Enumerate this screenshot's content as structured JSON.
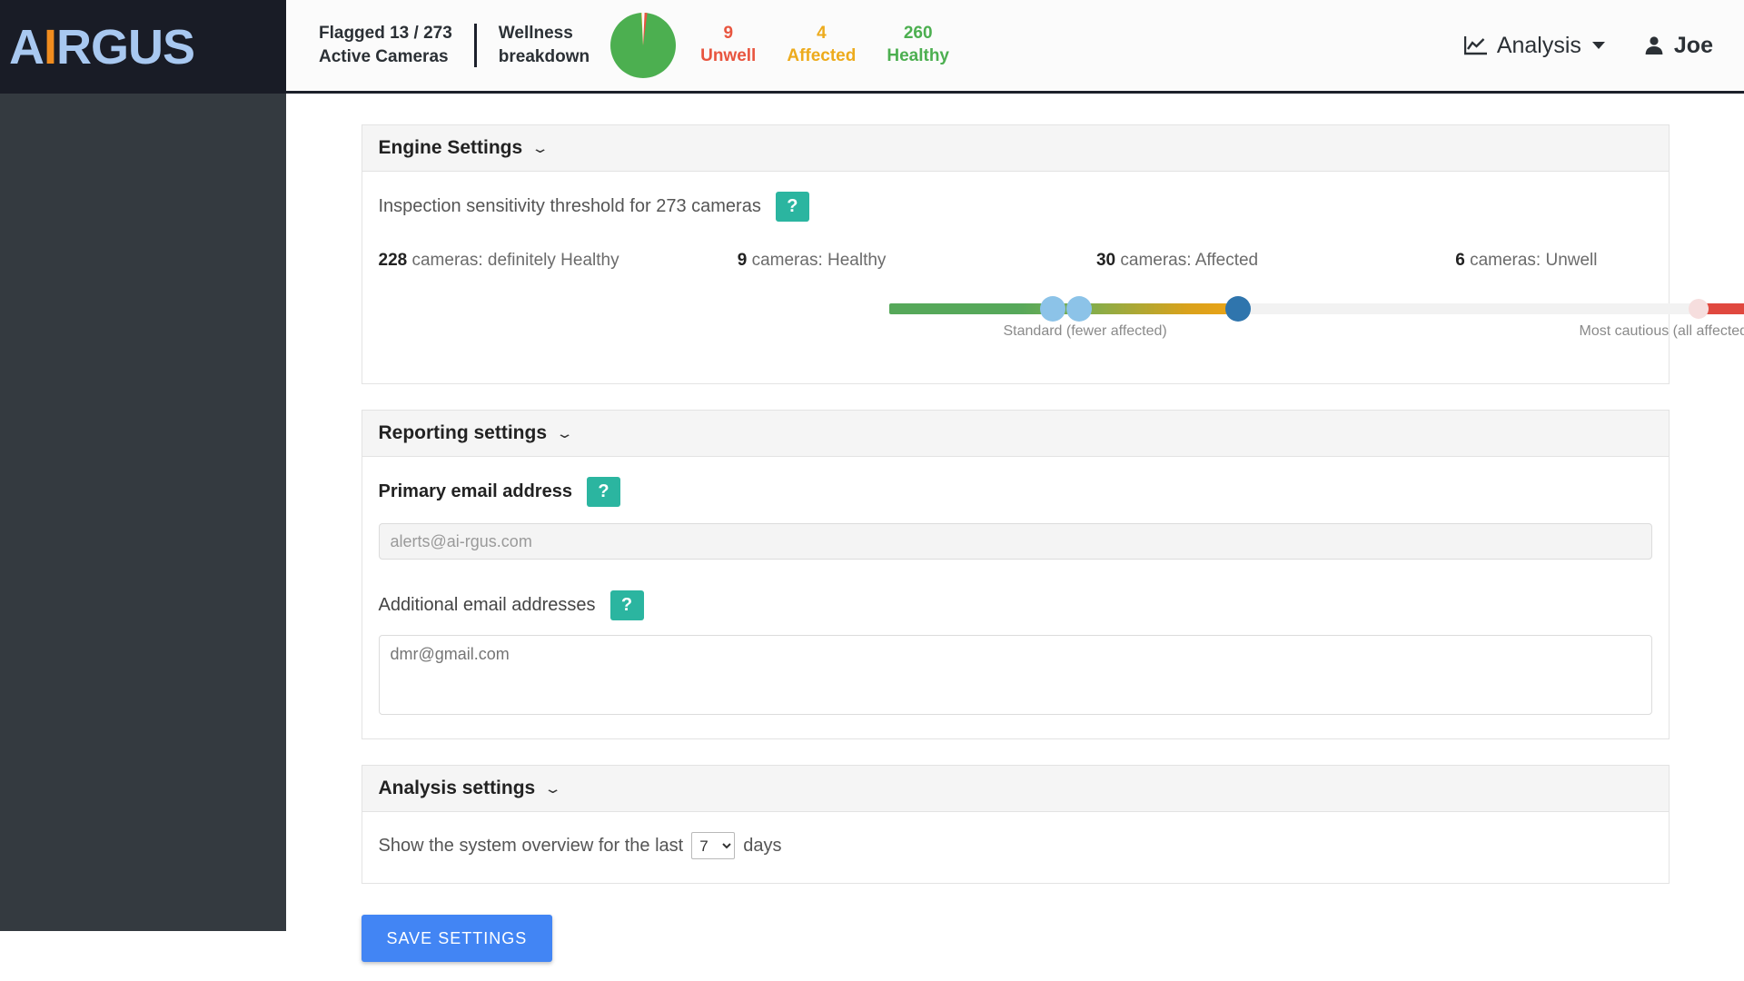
{
  "brand": {
    "name_part1": "A",
    "name_excl": "I",
    "name_part2": "RGUS",
    "logo_color": "#a8c8f0",
    "accent_color": "#f08c1e"
  },
  "header": {
    "flagged_line1": "Flagged 13 / 273",
    "flagged_line2": "Active Cameras",
    "wellness_line1": "Wellness",
    "wellness_line2": "breakdown",
    "metrics": [
      {
        "value": "9",
        "label": "Unwell",
        "color": "#e8553f"
      },
      {
        "value": "4",
        "label": "Affected",
        "color": "#edab1c"
      },
      {
        "value": "260",
        "label": "Healthy",
        "color": "#4caf50"
      }
    ],
    "nav_analysis": "Analysis",
    "user_name": "Joe"
  },
  "chart_data": {
    "type": "pie",
    "title": "Wellness breakdown",
    "categories": [
      "Healthy",
      "Affected",
      "Unwell"
    ],
    "values": [
      260,
      4,
      9
    ],
    "colors": [
      "#4caf50",
      "#edab1c",
      "#e8553f"
    ],
    "total": 273,
    "legend": "right"
  },
  "engine": {
    "title": "Engine Settings",
    "sensitivity_label": "Inspection sensitivity threshold for 273 cameras",
    "help": "?",
    "counts": [
      {
        "value": "228",
        "text": "cameras: definitely Healthy"
      },
      {
        "value": "9",
        "text": "cameras: Healthy"
      },
      {
        "value": "30",
        "text": "cameras: Affected"
      },
      {
        "value": "6",
        "text": "cameras: Unwell"
      }
    ],
    "slider_caption_standard": "Standard (fewer affected)",
    "slider_caption_cautious": "Most cautious (all affected)"
  },
  "reporting": {
    "title": "Reporting settings",
    "primary_label": "Primary email address",
    "primary_help": "?",
    "primary_value": "alerts@ai-rgus.com",
    "additional_label": "Additional email addresses",
    "additional_help": "?",
    "additional_value": "dmr@gmail.com"
  },
  "analysis": {
    "title": "Analysis settings",
    "overview_prefix": "Show the system overview for the last",
    "days_value": "7",
    "overview_suffix": "days"
  },
  "actions": {
    "save_label": "SAVE SETTINGS"
  }
}
